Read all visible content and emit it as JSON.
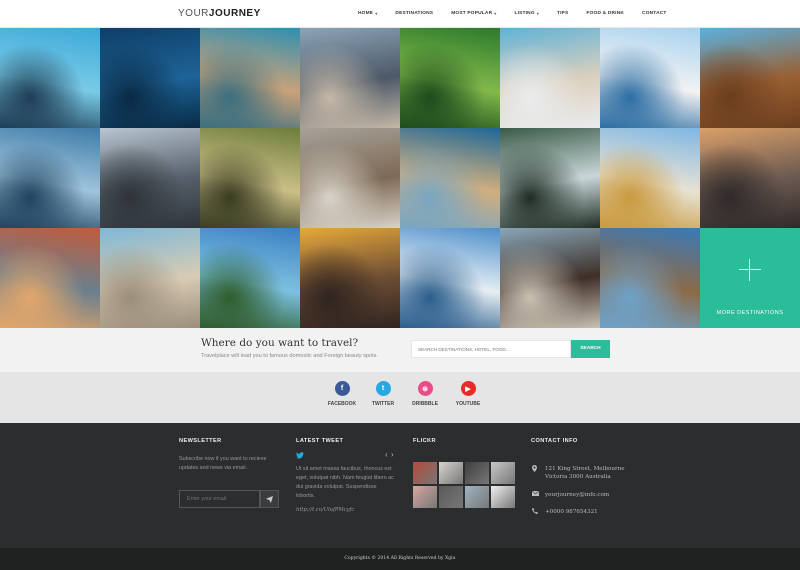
{
  "header": {
    "logo_light": "YOUR",
    "logo_bold": "JOURNEY",
    "nav": [
      {
        "label": "HOME",
        "caret": true
      },
      {
        "label": "DESTINATIONS",
        "caret": false
      },
      {
        "label": "MOST POPULAR",
        "caret": true
      },
      {
        "label": "LISTING",
        "caret": true
      },
      {
        "label": "TIPS",
        "caret": false
      },
      {
        "label": "FOOD & DRINK",
        "caret": false
      },
      {
        "label": "CONTACT",
        "caret": false
      }
    ]
  },
  "grid": {
    "photos": [
      {
        "name": "overwater-bungalow-photo",
        "colors": [
          "#3da9d8",
          "#79cbe6",
          "#1f3d55"
        ]
      },
      {
        "name": "swimmer-ocean-photo",
        "colors": [
          "#0f3e67",
          "#1e6498",
          "#0a2a44"
        ]
      },
      {
        "name": "harbor-boats-photo",
        "colors": [
          "#2f8fb0",
          "#c9a27a",
          "#3c6f7f"
        ]
      },
      {
        "name": "city-skyline-photo",
        "colors": [
          "#8da4b7",
          "#4d5967",
          "#c4b7a6"
        ]
      },
      {
        "name": "rice-terraces-photo",
        "colors": [
          "#2c7a2c",
          "#83b94a",
          "#1d4b1d"
        ]
      },
      {
        "name": "beach-pier-photo",
        "colors": [
          "#5fb3d6",
          "#dccfbd",
          "#e9ecee"
        ]
      },
      {
        "name": "boardwalk-railing-photo",
        "colors": [
          "#a9d2ee",
          "#f2f2f2",
          "#2d6ea3"
        ]
      },
      {
        "name": "wooden-deck-sea-photo",
        "colors": [
          "#5ab1df",
          "#9a5f33",
          "#6b3e1e"
        ]
      },
      {
        "name": "fishing-rod-sea-photo",
        "colors": [
          "#3e7ba8",
          "#9fc4db",
          "#20435f"
        ]
      },
      {
        "name": "city-street-photo",
        "colors": [
          "#b9c6cf",
          "#57606b",
          "#2f343a"
        ]
      },
      {
        "name": "traveler-suitcase-photo",
        "colors": [
          "#6c7d3a",
          "#cbbf88",
          "#3a3d22"
        ]
      },
      {
        "name": "sand-dunes-photo",
        "colors": [
          "#a6a29a",
          "#7e6a56",
          "#d8d3c9"
        ]
      },
      {
        "name": "coastline-aerial-photo",
        "colors": [
          "#1f6797",
          "#cfae7e",
          "#7aa6c2"
        ]
      },
      {
        "name": "pine-forest-photo",
        "colors": [
          "#3a5b48",
          "#c9d6d8",
          "#1e2d24"
        ]
      },
      {
        "name": "temple-photo",
        "colors": [
          "#7fb6e3",
          "#e8e2d3",
          "#c99a3f"
        ]
      },
      {
        "name": "skyline-sunset-photo",
        "colors": [
          "#d9a06a",
          "#6c5a52",
          "#2f2a2a"
        ]
      },
      {
        "name": "cliff-village-photo",
        "colors": [
          "#c25b3d",
          "#6a7f8e",
          "#e3a66a"
        ]
      },
      {
        "name": "couple-beach-photo",
        "colors": [
          "#7fb8d6",
          "#d8cbb4",
          "#9b8e7a"
        ]
      },
      {
        "name": "palm-tree-beach-photo",
        "colors": [
          "#3b7fc2",
          "#7cc1e0",
          "#2f5d2c"
        ]
      },
      {
        "name": "yellow-taxi-photo",
        "colors": [
          "#e7a93a",
          "#6d4e34",
          "#2f2420"
        ]
      },
      {
        "name": "greek-island-photo",
        "colors": [
          "#4f8fca",
          "#e6eef3",
          "#2b5e8c"
        ]
      },
      {
        "name": "dead-trees-photo",
        "colors": [
          "#8aa6b7",
          "#3e2f28",
          "#c9c0b2"
        ]
      },
      {
        "name": "river-tower-photo",
        "colors": [
          "#3a79b7",
          "#8c6a48",
          "#6ea2c9"
        ]
      }
    ],
    "more_label": "MORE DESTINATIONS"
  },
  "search": {
    "title": "Where do you want to travel?",
    "subtitle": "Travelplace will lead you to famous domestic and Foreign beauty spots.",
    "placeholder": "SEARCH DESTINATIONS, HOTEL, FOOD...",
    "button": "SEARCH"
  },
  "social": [
    {
      "label": "FACEBOOK",
      "glyph": "f",
      "color": "#3b5998",
      "icon": "facebook-icon"
    },
    {
      "label": "TWITTER",
      "glyph": "t",
      "color": "#26a9e0",
      "icon": "twitter-icon"
    },
    {
      "label": "DRIBBBLE",
      "glyph": "⊛",
      "color": "#ea4c89",
      "icon": "dribbble-icon"
    },
    {
      "label": "YOUTUBE",
      "glyph": "▶",
      "color": "#e52d27",
      "icon": "youtube-icon"
    }
  ],
  "footer": {
    "newsletter": {
      "heading": "NEWSLETTER",
      "text": "Subscribe now if you want to recieve updates and news via email.",
      "placeholder": "Enter your email"
    },
    "tweet": {
      "heading": "LATEST TWEET",
      "text": "Ut sit amet massa faucibus, rhoncus est eget, volutpat nibh. Nam feugiat libero ac dui gravida volutpat. Suspendisse lobortis.",
      "link": "http://t.co/UlufPMcyfc",
      "prev": "‹",
      "next": "›"
    },
    "flickr": {
      "heading": "FLICKR",
      "thumbs": [
        "#b34a3a",
        "#d9d4cf",
        "#3f3f3f",
        "#c8c8c8",
        "#d6a7a0",
        "#5a5a5a",
        "#9fb3c4",
        "#f0f0f0"
      ]
    },
    "contact": {
      "heading": "CONTACT INFO",
      "address_line1": "121 King Street, Melbourne",
      "address_line2": "Victoria 3000 Australia",
      "email": "yourjourney@info.com",
      "phone": "+0000 987654321"
    },
    "copyright": "Copyrights © 2014 All Rights Reserved by Xgiu"
  },
  "colors": {
    "accent": "#2bbc9a",
    "footer_bg": "#2b2d2e"
  }
}
